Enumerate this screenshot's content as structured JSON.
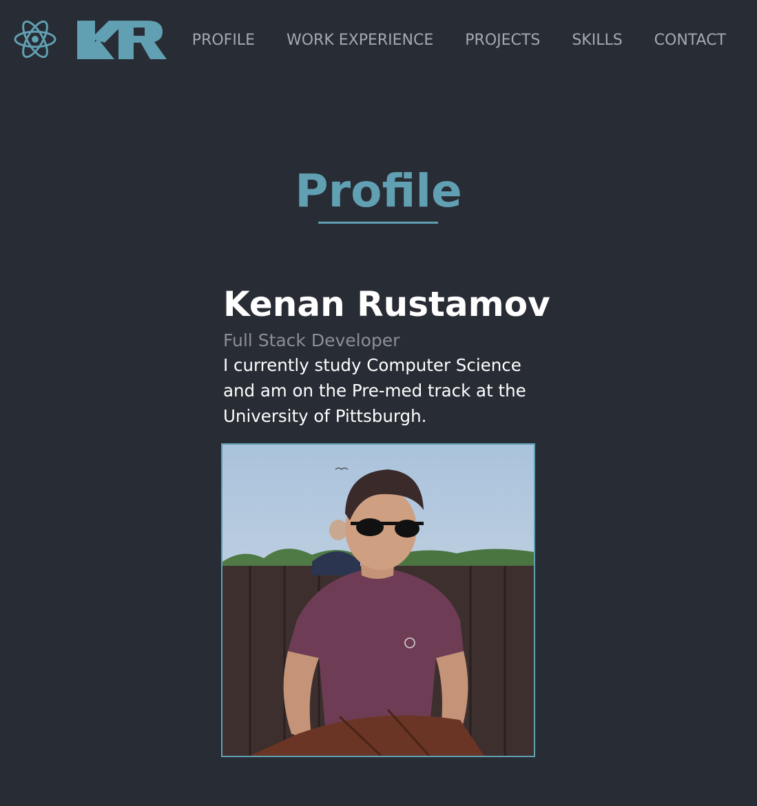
{
  "header": {
    "logo_text": "KR",
    "nav": [
      {
        "label": "PROFILE"
      },
      {
        "label": "WORK EXPERIENCE"
      },
      {
        "label": "PROJECTS"
      },
      {
        "label": "SKILLS"
      },
      {
        "label": "CONTACT"
      }
    ]
  },
  "profile": {
    "section_title": "Profile",
    "name": "Kenan Rustamov",
    "role": "Full Stack Developer",
    "bio": "I currently study Computer Science and am on the Pre-med track at the University of Pittsburgh."
  },
  "colors": {
    "background": "#282c34",
    "accent": "#61a0b3",
    "nav_text": "#a5aab2",
    "role_text": "#8c8f94"
  },
  "icons": {
    "logo_mark": "atom-icon"
  }
}
